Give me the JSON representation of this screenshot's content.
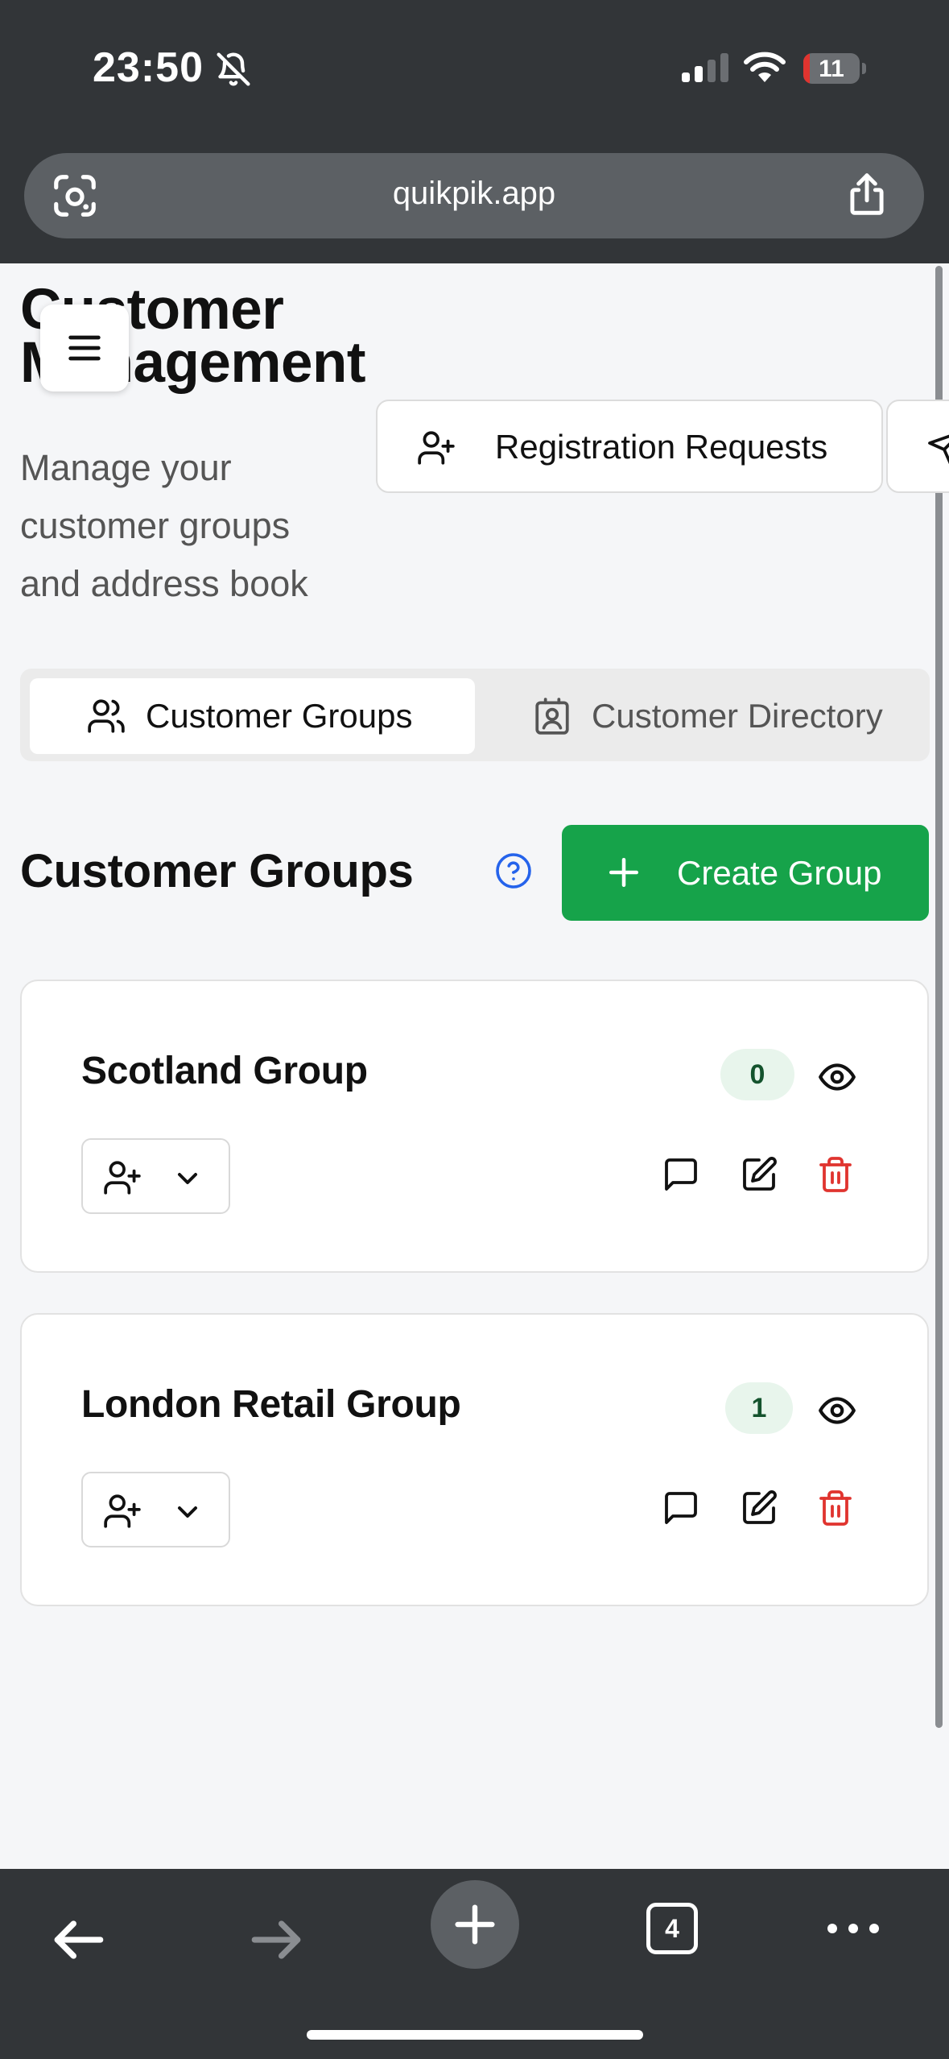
{
  "status_bar": {
    "time": "23:50",
    "battery": "11",
    "battery_fraction": 0.11
  },
  "browser": {
    "url": "quikpik.app",
    "tab_count": "4"
  },
  "page": {
    "title_line1": "Customer",
    "title_line2": "Management",
    "subtitle": "Manage your customer groups and address book",
    "registration_button": "Registration Requests"
  },
  "tabs": [
    {
      "label": "Customer Groups",
      "active": true
    },
    {
      "label": "Customer Directory",
      "active": false
    }
  ],
  "section": {
    "title": "Customer Groups",
    "create_label": "Create Group"
  },
  "groups": [
    {
      "name": "Scotland Group",
      "count": "0"
    },
    {
      "name": "London Retail Group",
      "count": "1"
    }
  ],
  "colors": {
    "primary_green": "#16a34a",
    "delete_red": "#e0342f",
    "help_blue": "#2563eb"
  }
}
